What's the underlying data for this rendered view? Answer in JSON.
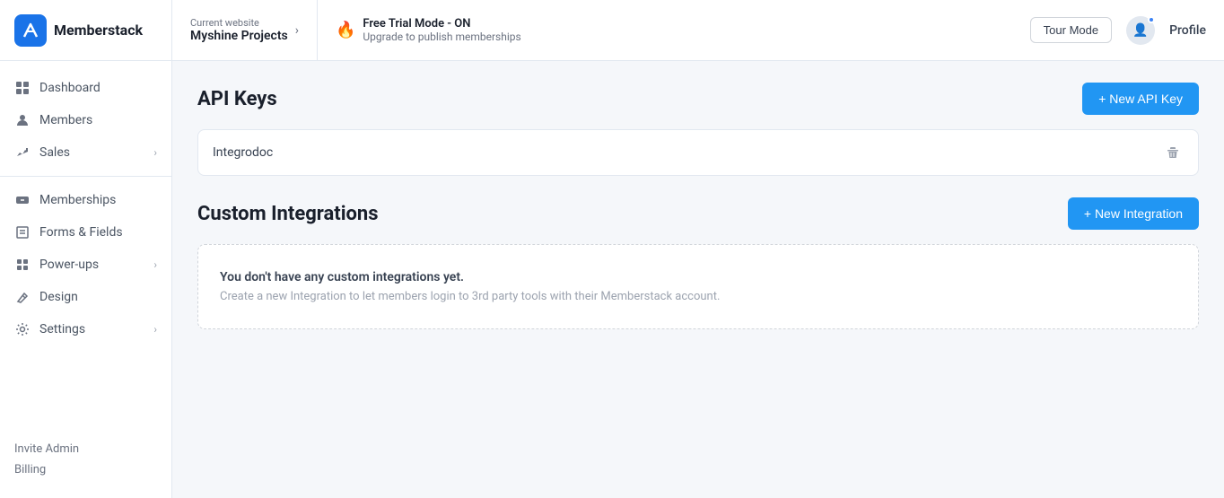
{
  "app": {
    "logo_text": "Memberstack",
    "logo_initials": "M"
  },
  "topbar": {
    "current_site_label": "Current website",
    "current_site_name": "Myshine Projects",
    "trial_title": "Free Trial Mode - ON",
    "trial_subtitle": "Upgrade to publish memberships",
    "trial_icon": "🔥",
    "tour_mode_label": "Tour Mode",
    "profile_label": "Profile"
  },
  "sidebar": {
    "items": [
      {
        "id": "dashboard",
        "label": "Dashboard",
        "icon": "dashboard",
        "has_chevron": false
      },
      {
        "id": "members",
        "label": "Members",
        "icon": "members",
        "has_chevron": false
      },
      {
        "id": "sales",
        "label": "Sales",
        "icon": "sales",
        "has_chevron": true
      },
      {
        "id": "memberships",
        "label": "Memberships",
        "icon": "memberships",
        "has_chevron": false
      },
      {
        "id": "forms-fields",
        "label": "Forms & Fields",
        "icon": "forms",
        "has_chevron": false
      },
      {
        "id": "power-ups",
        "label": "Power-ups",
        "icon": "powerups",
        "has_chevron": true
      },
      {
        "id": "design",
        "label": "Design",
        "icon": "design",
        "has_chevron": false
      },
      {
        "id": "settings",
        "label": "Settings",
        "icon": "settings",
        "has_chevron": true
      }
    ],
    "footer_links": [
      {
        "id": "invite-admin",
        "label": "Invite Admin"
      },
      {
        "id": "billing",
        "label": "Billing"
      }
    ]
  },
  "api_keys": {
    "section_title": "API Keys",
    "new_button_label": "+ New API Key",
    "keys": [
      {
        "name": "Integrodoc"
      }
    ]
  },
  "custom_integrations": {
    "section_title": "Custom Integrations",
    "new_button_label": "+ New Integration",
    "empty_state_title": "You don't have any custom integrations yet.",
    "empty_state_subtitle": "Create a new Integration to let members login to 3rd party tools with their Memberstack account."
  },
  "icons": {
    "delete": "🗑",
    "plus": "+",
    "chevron_right": "›"
  }
}
